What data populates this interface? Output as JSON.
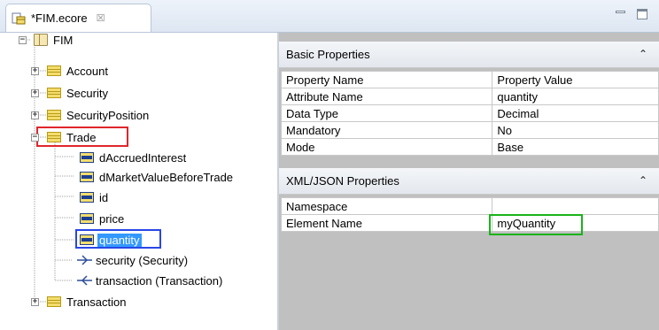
{
  "editor": {
    "tab_title": "*FIM.ecore",
    "close_glyph": "☒"
  },
  "tree": {
    "root": "FIM",
    "classes": [
      "Account",
      "Security",
      "SecurityPosition"
    ],
    "trade": "Trade",
    "trade_children": {
      "attributes": [
        "dAccruedInterest",
        "dMarketValueBeforeTrade",
        "id",
        "price",
        "quantity"
      ],
      "references": [
        "security (Security)",
        "transaction (Transaction)"
      ]
    },
    "last_class": "Transaction"
  },
  "basic_properties": {
    "title": "Basic Properties",
    "header": [
      "Property Name",
      "Property Value"
    ],
    "rows": [
      [
        "Attribute Name",
        "quantity"
      ],
      [
        "Data Type",
        "Decimal"
      ],
      [
        "Mandatory",
        "No"
      ],
      [
        "Mode",
        "Base"
      ]
    ]
  },
  "xml_json_properties": {
    "title": "XML/JSON Properties",
    "rows": [
      [
        "Namespace",
        ""
      ],
      [
        "Element Name",
        "myQuantity"
      ]
    ]
  },
  "colors": {
    "highlight_red": "#e0262b",
    "highlight_blue": "#2847e6",
    "highlight_green": "#19b419",
    "selection": "#3399ff"
  }
}
